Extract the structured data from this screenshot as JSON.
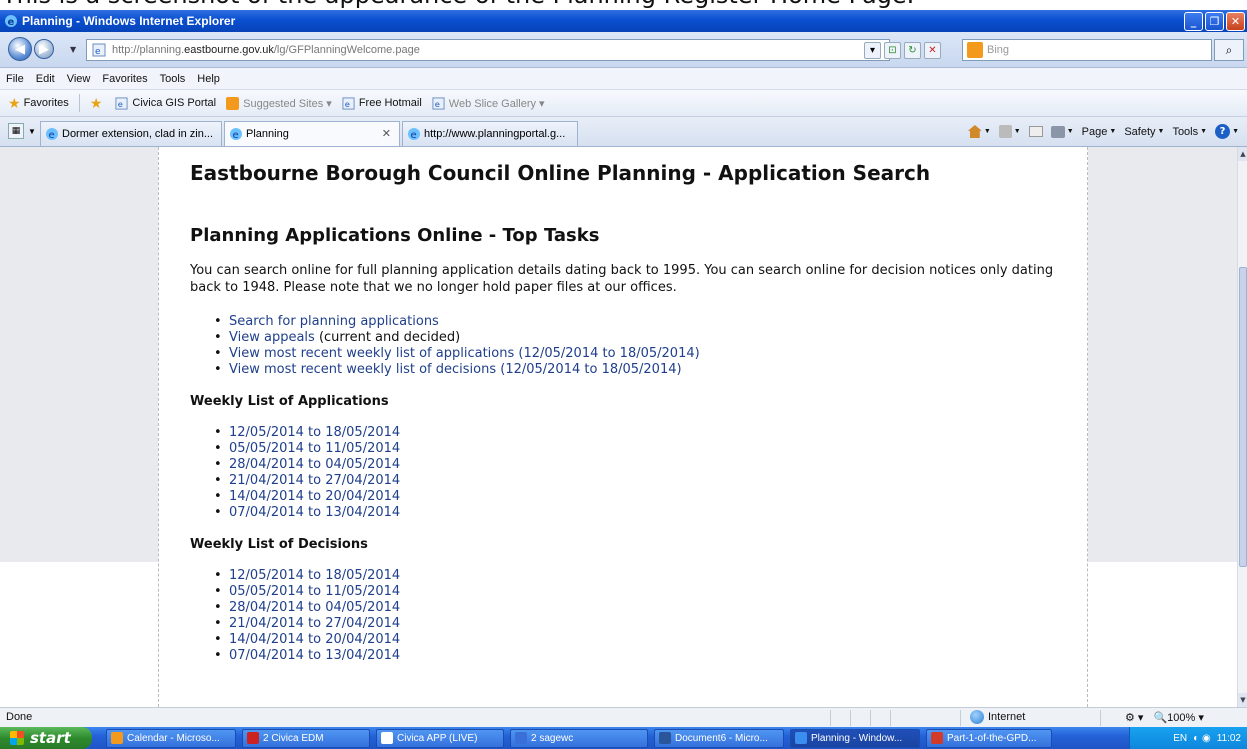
{
  "caption": "This is a screenshot of the appearance of the Planning Register Home Page.",
  "window": {
    "title": "Planning - Windows Internet Explorer",
    "minimize": "_",
    "maximize": "❐",
    "close": "✕"
  },
  "address": {
    "url_prefix": "http://planning.",
    "url_domain": "eastbourne.gov.uk",
    "url_path": "/lg/GFPlanningWelcome.page",
    "search_placeholder": "Bing"
  },
  "menu": [
    "File",
    "Edit",
    "View",
    "Favorites",
    "Tools",
    "Help"
  ],
  "favorites": {
    "label": "Favorites",
    "items": [
      {
        "label": "Civica GIS Portal",
        "muted": false
      },
      {
        "label": "Suggested Sites ▾",
        "muted": true
      },
      {
        "label": "Free Hotmail",
        "muted": false
      },
      {
        "label": "Web Slice Gallery ▾",
        "muted": true
      }
    ]
  },
  "tabs": [
    {
      "label": "Dormer extension, clad in zin..."
    },
    {
      "label": "Planning",
      "close": "✕"
    },
    {
      "label": "http://www.planningportal.g..."
    }
  ],
  "commands": [
    "Page",
    "Safety",
    "Tools"
  ],
  "page": {
    "site_title": "Eastbourne Borough Council Online Planning - Application Search",
    "heading": "Planning Applications Online - Top Tasks",
    "intro": "You can search online for full planning application details dating back to 1995. You can search online for decision notices only dating back to 1948. Please note that we no longer hold paper files at our offices.",
    "top_tasks": [
      {
        "link": "Search for planning applications",
        "suffix": ""
      },
      {
        "link": "View appeals",
        "suffix": " (current and decided)"
      },
      {
        "link": "View most recent weekly list of applications (12/05/2014 to 18/05/2014)",
        "suffix": ""
      },
      {
        "link": "View most recent weekly list of decisions (12/05/2014 to 18/05/2014)",
        "suffix": ""
      }
    ],
    "applications_heading": "Weekly List of Applications",
    "applications": [
      "12/05/2014 to 18/05/2014",
      "05/05/2014 to 11/05/2014",
      "28/04/2014 to 04/05/2014",
      "21/04/2014 to 27/04/2014",
      "14/04/2014 to 20/04/2014",
      "07/04/2014 to 13/04/2014"
    ],
    "decisions_heading": "Weekly List of Decisions",
    "decisions": [
      "12/05/2014 to 18/05/2014",
      "05/05/2014 to 11/05/2014",
      "28/04/2014 to 04/05/2014",
      "21/04/2014 to 27/04/2014",
      "14/04/2014 to 20/04/2014",
      "07/04/2014 to 13/04/2014"
    ]
  },
  "status": {
    "text": "Done",
    "zone": "Internet",
    "zoom": "100%"
  },
  "taskbar": {
    "start": "start",
    "items": [
      {
        "label": "Calendar - Microso...",
        "color": "#f39a1d"
      },
      {
        "label": "2 Civica EDM",
        "color": "#cc2222"
      },
      {
        "label": "Civica APP (LIVE)",
        "color": "#ffffff"
      },
      {
        "label": "2 sagewc",
        "color": "#3a6fd8"
      },
      {
        "label": "Document6 - Micro...",
        "color": "#2b579a"
      },
      {
        "label": "Planning - Window...",
        "color": "#3b8df0"
      },
      {
        "label": "Part-1-of-the-GPD...",
        "color": "#d23b2a"
      }
    ],
    "lang": "EN",
    "time": "11:02"
  }
}
